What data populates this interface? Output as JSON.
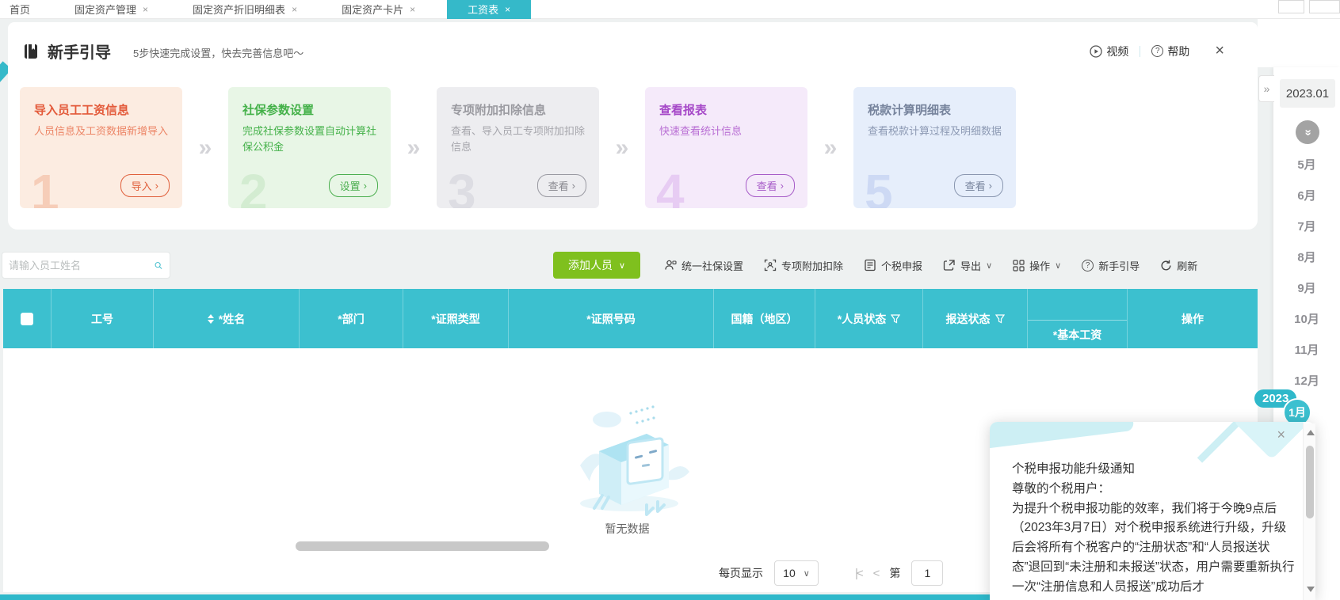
{
  "glyphs": {
    "close": "×",
    "caret_down": "∨",
    "angle_right": "›",
    "double_chevron_right": "»",
    "double_chevron_up": "«",
    "question_mark": "?",
    "first_page": "|<",
    "prev_page": "<"
  },
  "tabbar": {
    "tabs": [
      {
        "label": "首页"
      },
      {
        "label": "固定资产管理"
      },
      {
        "label": "固定资产折旧明细表"
      },
      {
        "label": "固定资产卡片"
      },
      {
        "label": "工资表"
      }
    ]
  },
  "guide": {
    "title": "新手引导",
    "subtitle": "5步快速完成设置，快去完善信息吧～",
    "video_label": "视频",
    "help_label": "帮助",
    "steps": [
      {
        "num": "1",
        "title": "导入员工工资信息",
        "desc": "人员信息及工资数据新增导入",
        "action": "导入"
      },
      {
        "num": "2",
        "title": "社保参数设置",
        "desc": "完成社保参数设置自动计算社保公积金",
        "action": "设置"
      },
      {
        "num": "3",
        "title": "专项附加扣除信息",
        "desc": "查看、导入员工专项附加扣除信息",
        "action": "查看"
      },
      {
        "num": "4",
        "title": "查看报表",
        "desc": "快速查看统计信息",
        "action": "查看"
      },
      {
        "num": "5",
        "title": "税款计算明细表",
        "desc": "查看税款计算过程及明细数据",
        "action": "查看"
      }
    ]
  },
  "toolbar": {
    "search_placeholder": "请输入员工姓名",
    "add_button": "添加人员",
    "social_security": "统一社保设置",
    "special_deduction": "专项附加扣除",
    "tax_filing": "个税申报",
    "export": "导出",
    "operations": "操作",
    "newbie_guide": "新手引导",
    "refresh": "刷新"
  },
  "table": {
    "columns": [
      "工号",
      "*姓名",
      "*部门",
      "*证照类型",
      "*证照号码",
      "国籍（地区）",
      "*人员状态",
      "报送状态",
      "*基本工资",
      "操作"
    ],
    "empty_text": "暂无数据"
  },
  "pagination": {
    "per_page_label": "每页显示",
    "per_page": "10",
    "page_prefix": "第",
    "page": "1"
  },
  "period": {
    "selected": "2023.01",
    "months": [
      "5月",
      "6月",
      "7月",
      "8月",
      "9月",
      "10月",
      "11月",
      "12月"
    ],
    "year_badge": "2023",
    "month_badge": "1月"
  },
  "notice": {
    "title": "个税申报功能升级通知",
    "greeting": "尊敬的个税用户：",
    "body": "为提升个税申报功能的效率，我们将于今晚9点后（2023年3月7日）对个税申报系统进行升级，升级后会将所有个税客户的“注册状态”和“人员报送状态”退回到“未注册和未报送”状态，用户需要重新执行一次“注册信息和人员报送”成功后才"
  },
  "colors": {
    "accent": "#35b9c9",
    "table_header": "#3cc0cf",
    "add_green": "#7fc01e"
  }
}
